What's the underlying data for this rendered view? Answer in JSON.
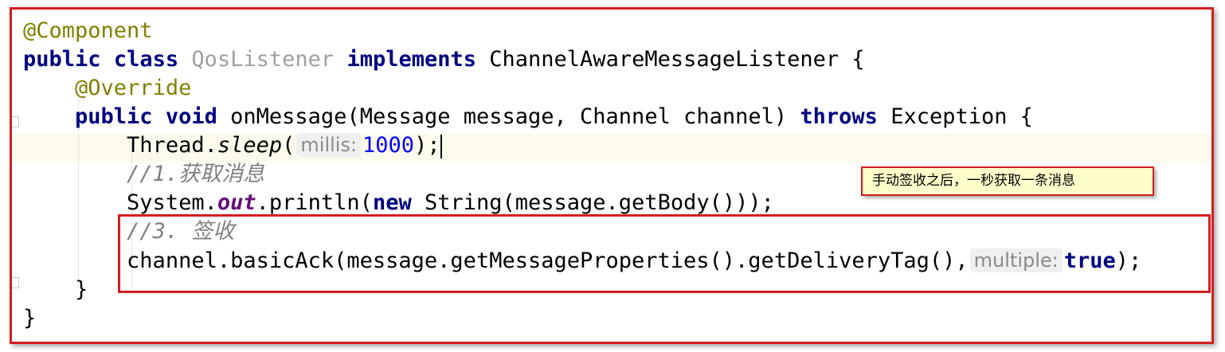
{
  "code": {
    "line1": {
      "annotation": "@Component"
    },
    "line2": {
      "kw_public": "public",
      "kw_class": "class",
      "class_name": "QosListener",
      "kw_implements": "implements",
      "interface_name": "ChannelAwareMessageListener",
      "brace": " {"
    },
    "line3": {
      "annotation": "@Override"
    },
    "line4": {
      "kw_public": "public",
      "kw_void": "void",
      "signature": "onMessage(Message message, Channel channel)",
      "kw_throws": "throws",
      "exception": "Exception {"
    },
    "line5": {
      "receiver": "Thread.",
      "method": "sleep",
      "open": "(",
      "hint": "millis:",
      "number": "1000",
      "close": ");"
    },
    "line6": {
      "comment": "//1.获取消息"
    },
    "line7": {
      "prefix": "System.",
      "field": "out",
      "call": ".println(",
      "kw_new": "new",
      "rest": " String(message.getBody()));"
    },
    "line8": {
      "comment": "//3. 签收"
    },
    "line9": {
      "call": "channel.basicAck(message.getMessageProperties().getDeliveryTag(),",
      "hint": "multiple:",
      "kw_true": "true",
      "close": ");"
    },
    "line10": {
      "brace": "}"
    },
    "line11": {
      "brace": "}"
    }
  },
  "callout": {
    "text": "手动签收之后，一秒获取一条消息"
  },
  "colors": {
    "border_red": "#d21e1e",
    "keyword": "#000080",
    "annotation": "#808000",
    "comment": "#808080",
    "number": "#0000ff",
    "static_field": "#660e7a",
    "callout_bg": "#ffffcc"
  }
}
